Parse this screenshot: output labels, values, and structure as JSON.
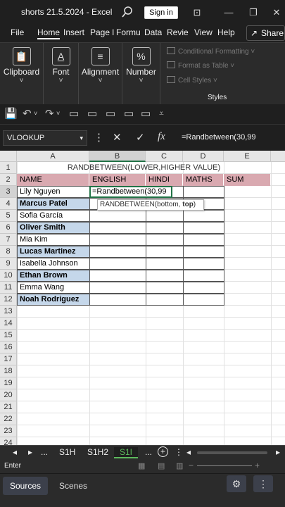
{
  "window": {
    "title": "shorts 21.5.2024  -  Excel",
    "signin": "Sign in",
    "minimize": "—",
    "restore": "❐",
    "close": "✕"
  },
  "ribbon_tabs": [
    "File",
    "Home",
    "Insert",
    "Page Layout",
    "Formulas",
    "Data",
    "Review",
    "View",
    "Help"
  ],
  "ribbon_tabs_display": [
    "File",
    "Home",
    "Insert",
    "Page l",
    "Formu",
    "Data",
    "Revie",
    "View",
    "Help"
  ],
  "share": "Share",
  "ribbon": {
    "clipboard": "Clipboard",
    "font": "Font",
    "alignment": "Alignment",
    "number": "Number",
    "number_icon": "%",
    "font_icon": "A",
    "conditional_formatting": "Conditional Formatting ˅",
    "format_as_table": "Format as Table ˅",
    "cell_styles": "Cell Styles ˅",
    "styles_group": "Styles"
  },
  "namebox": "VLOOKUP",
  "formula_bar": {
    "cancel": "✕",
    "enter": "✓",
    "fx": "fx",
    "content": "=Randbetween(30,99"
  },
  "columns": [
    "A",
    "B",
    "C",
    "D",
    "E"
  ],
  "rows": [
    "1",
    "2",
    "3",
    "4",
    "5",
    "6",
    "7",
    "8",
    "9",
    "10",
    "11",
    "12",
    "13",
    "14",
    "15",
    "16",
    "17",
    "18",
    "19",
    "20",
    "21",
    "22",
    "23",
    "24"
  ],
  "sheet": {
    "title_row": "RANDBETWEEN(LOWER,HIGHER VALUE)",
    "headers": [
      "NAME",
      "ENGLISH",
      "HINDI",
      "MATHS",
      "SUM"
    ],
    "names": [
      "Lily Nguyen",
      "Marcus Patel",
      "Sofia García",
      "Oliver Smith",
      "Mia Kim",
      "Lucas Martinez",
      "Isabella Johnson",
      "Ethan Brown",
      "Emma Wang",
      "Noah Rodriguez"
    ],
    "active_cell_text": "=Randbetween(30,99",
    "tooltip_prefix": "RANDBETWEEN(bottom, ",
    "tooltip_bold": "top",
    "tooltip_suffix": ")"
  },
  "sheet_tabs": {
    "ellipsis_left": "...",
    "tab1": "S1H",
    "tab2": "S1H2",
    "tab3": "S1I",
    "ellipsis_right": "...",
    "add": "+"
  },
  "status": {
    "mode": "Enter"
  },
  "obs": {
    "sources": "Sources",
    "scenes": "Scenes"
  },
  "colors": {
    "header_fill": "#d9a9b0",
    "blue_fill": "#c5d7ea",
    "accent": "#217346"
  }
}
